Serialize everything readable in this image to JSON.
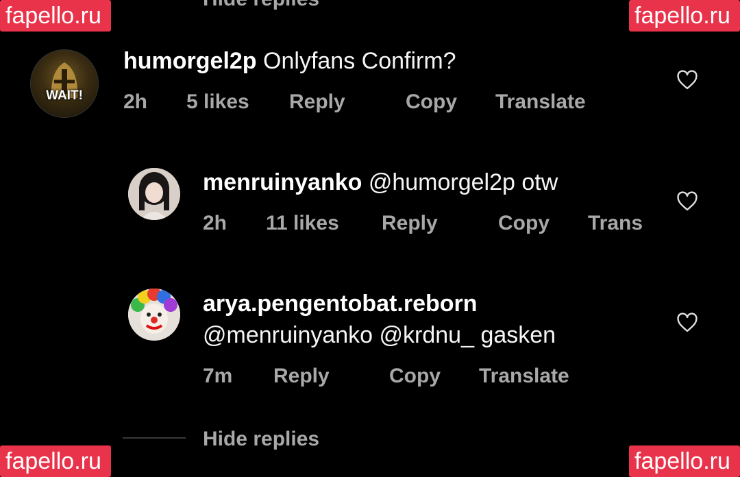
{
  "watermark": "fapello.ru",
  "top_partial_text": "Hide replies",
  "comments": [
    {
      "username": "humorgel2p",
      "text": "Onlyfans Confirm?",
      "time": "2h",
      "likes": "5 likes",
      "reply": "Reply",
      "copy": "Copy",
      "translate": "Translate",
      "avatar_text": "WAIT!"
    },
    {
      "username": "menruinyanko",
      "text": "@humorgel2p otw",
      "time": "2h",
      "likes": "11 likes",
      "reply": "Reply",
      "copy": "Copy",
      "translate": "Trans"
    },
    {
      "username": "arya.pengentobat.reborn",
      "text": "@menruinyanko @krdnu_ gasken",
      "time": "7m",
      "reply": "Reply",
      "copy": "Copy",
      "translate": "Translate"
    }
  ],
  "hide_replies": "Hide replies",
  "colors": {
    "background": "#000000",
    "watermark": "#e8334a",
    "meta_text": "#a8a8a8",
    "primary_text": "#ffffff"
  }
}
